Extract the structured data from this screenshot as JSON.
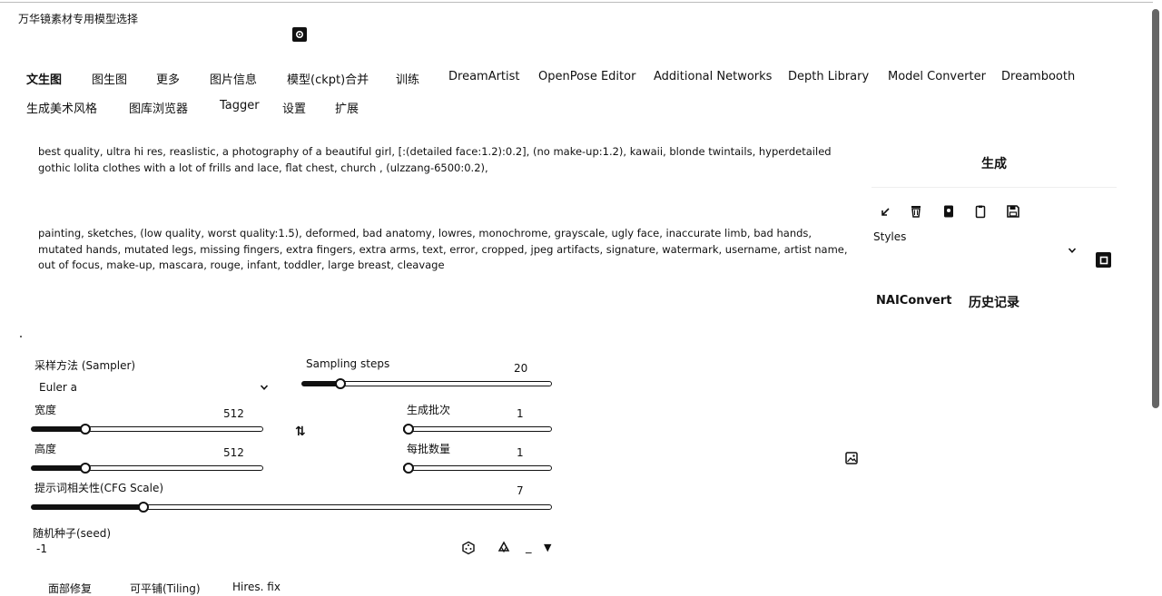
{
  "app": {
    "title": "万华镜素材专用模型选择"
  },
  "tabs_row1": [
    "文生图",
    "图生图",
    "更多",
    "图片信息",
    "模型(ckpt)合并",
    "训练",
    "DreamArtist",
    "OpenPose Editor",
    "Additional Networks",
    "Depth Library",
    "Model Converter",
    "Dreambooth"
  ],
  "tabs_row2": [
    "生成美术风格",
    "图库浏览器",
    "Tagger",
    "设置",
    "扩展"
  ],
  "prompt": {
    "positive": "best quality, ultra hi res, reaslistic, a photography of a beautiful girl, [:(detailed face:1.2):0.2], (no make-up:1.2), kawaii, blonde twintails, hyperdetailed gothic lolita clothes with a lot of frills and lace, flat chest, church , (ulzzang-6500:0.2),",
    "negative": "painting, sketches, (low quality, worst quality:1.5), deformed, bad anatomy, lowres, monochrome, grayscale, ugly face, inaccurate limb, bad hands, mutated hands, mutated legs, missing fingers, extra fingers, extra arms, text, error, cropped, jpeg artifacts, signature, watermark, username, artist name, out of focus, make-up, mascara, rouge, infant, toddler, large breast, cleavage"
  },
  "right_panel": {
    "generate_label": "生成",
    "styles_label": "Styles",
    "naiconvert_label": "NAIConvert",
    "history_label": "历史记录"
  },
  "sampler": {
    "label": "采样方法 (Sampler)",
    "value": "Euler a"
  },
  "sampling_steps": {
    "label": "Sampling steps",
    "value": "20",
    "fraction": 0.14
  },
  "width": {
    "label": "宽度",
    "value": "512",
    "fraction": 0.22
  },
  "height": {
    "label": "高度",
    "value": "512",
    "fraction": 0.22
  },
  "batch_count": {
    "label": "生成批次",
    "value": "1",
    "fraction": 0.0
  },
  "batch_size": {
    "label": "每批数量",
    "value": "1",
    "fraction": 0.0
  },
  "cfg_scale": {
    "label": "提示词相关性(CFG Scale)",
    "value": "7",
    "fraction": 0.21
  },
  "seed": {
    "label": "随机种子(seed)",
    "value": "-1",
    "dash": "_",
    "arrow": "▼"
  },
  "bottom_options": [
    "面部修复",
    "可平铺(Tiling)",
    "Hires. fix"
  ],
  "swap_symbol": "⇅"
}
